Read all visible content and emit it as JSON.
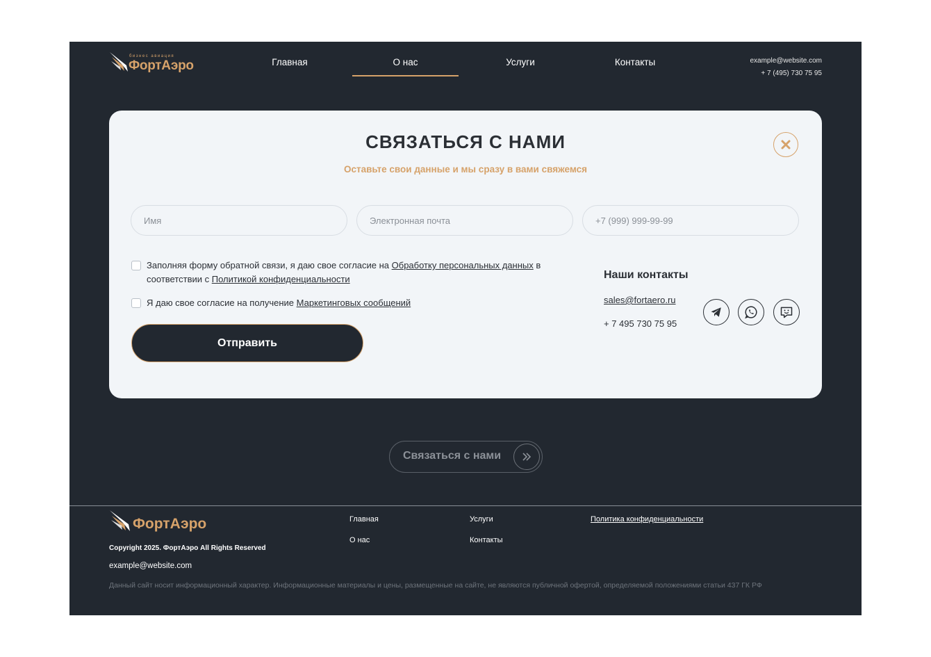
{
  "header": {
    "logo": {
      "small_text": "бизнес авиация",
      "brand": "ФортАэро"
    },
    "nav": [
      {
        "label": "Главная",
        "active": false
      },
      {
        "label": "О нас",
        "active": true
      },
      {
        "label": "Услуги",
        "active": false
      },
      {
        "label": "Контакты",
        "active": false
      }
    ],
    "email": "example@website.com",
    "phone": "+ 7 (495) 730 75 95"
  },
  "modal": {
    "title": "СВЯЗАТЬСЯ С НАМИ",
    "subtitle": "Оставьте свои данные и мы сразу в вами свяжемся",
    "fields": {
      "name_placeholder": "Имя",
      "email_placeholder": "Электронная почта",
      "phone_placeholder": "+7 (999) 999-99-99"
    },
    "consent1": {
      "prefix": "Заполняя форму обратной связи, я даю свое согласие на ",
      "link1": "Обработку персональных данных",
      "middle": " в соответствии с ",
      "link2": "Политикой конфиденциальности"
    },
    "consent2": {
      "prefix": "Я даю свое согласие на получение ",
      "link": "Маркетинговых сообщений"
    },
    "submit_label": "Отправить",
    "contacts": {
      "title": "Наши контакты",
      "email": "sales@fortaero.ru ",
      "phone": "+ 7 495 730 75 95",
      "socials": [
        "telegram-icon",
        "whatsapp-icon",
        "chat-icon"
      ]
    }
  },
  "cta": {
    "label": "Связаться с нами"
  },
  "footer": {
    "brand": "ФортАэро",
    "copyright": "Copyright 2025. ФортАэро All Rights Reserved",
    "email": "example@website.com",
    "links_col1": [
      "Главная",
      "О нас"
    ],
    "links_col2": [
      "Услуги",
      "Контакты"
    ],
    "policy": "Политика конфиденциальности",
    "disclaimer": "Данный сайт носит информационный характер. Информационные материалы и цены, размещенные на сайте, не являются публичной офертой, определяемой положениями статьи 437 ГК РФ"
  },
  "colors": {
    "background": "#222830",
    "accent": "#d6a26a",
    "card": "#f2f5f8"
  }
}
